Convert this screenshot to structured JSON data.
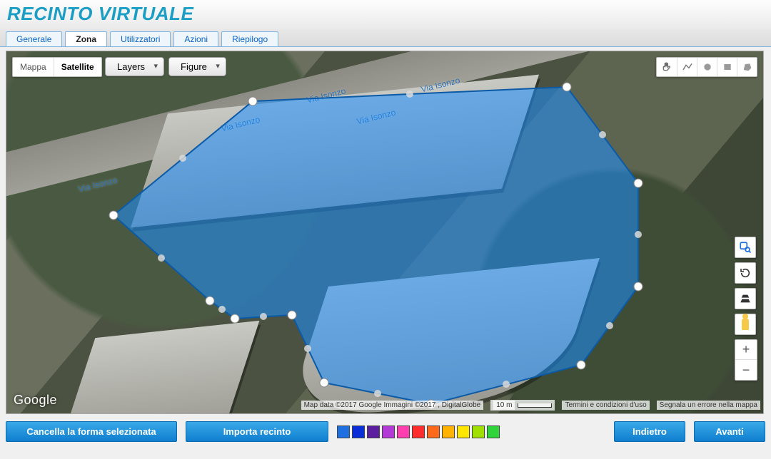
{
  "title": "RECINTO VIRTUALE",
  "tabs": [
    {
      "label": "Generale"
    },
    {
      "label": "Zona",
      "active": true
    },
    {
      "label": "Utilizzatori"
    },
    {
      "label": "Azioni"
    },
    {
      "label": "Riepilogo"
    }
  ],
  "map": {
    "type_options": {
      "map": "Mappa",
      "satellite": "Satellite",
      "selected": "Satellite"
    },
    "dropdowns": {
      "layers": "Layers",
      "figure": "Figure"
    },
    "street_labels": [
      "Via Isonzo",
      "Via Isonzo",
      "Via Isonzo",
      "Via Isonzo",
      "Via Isonzo"
    ],
    "logo": "Google",
    "attribution": "Map data ©2017 Google Immagini ©2017 , DigitalGlobe",
    "scale_label": "10 m",
    "terms": "Termini e condizioni d'uso",
    "report": "Segnala un errore nella mappa",
    "draw_tools": [
      "pan-icon",
      "polyline-icon",
      "circle-icon",
      "rectangle-icon",
      "polygon-icon"
    ]
  },
  "footer": {
    "delete_shape": "Cancella la forma selezionata",
    "import": "Importa recinto",
    "back": "Indietro",
    "next": "Avanti",
    "palette": [
      "#1e6fe0",
      "#0a2fd6",
      "#5a1e9e",
      "#b43ad6",
      "#ff3fb0",
      "#ff2d2d",
      "#ff6a1a",
      "#ffb300",
      "#ffe600",
      "#9fe000",
      "#2fd33a"
    ]
  }
}
